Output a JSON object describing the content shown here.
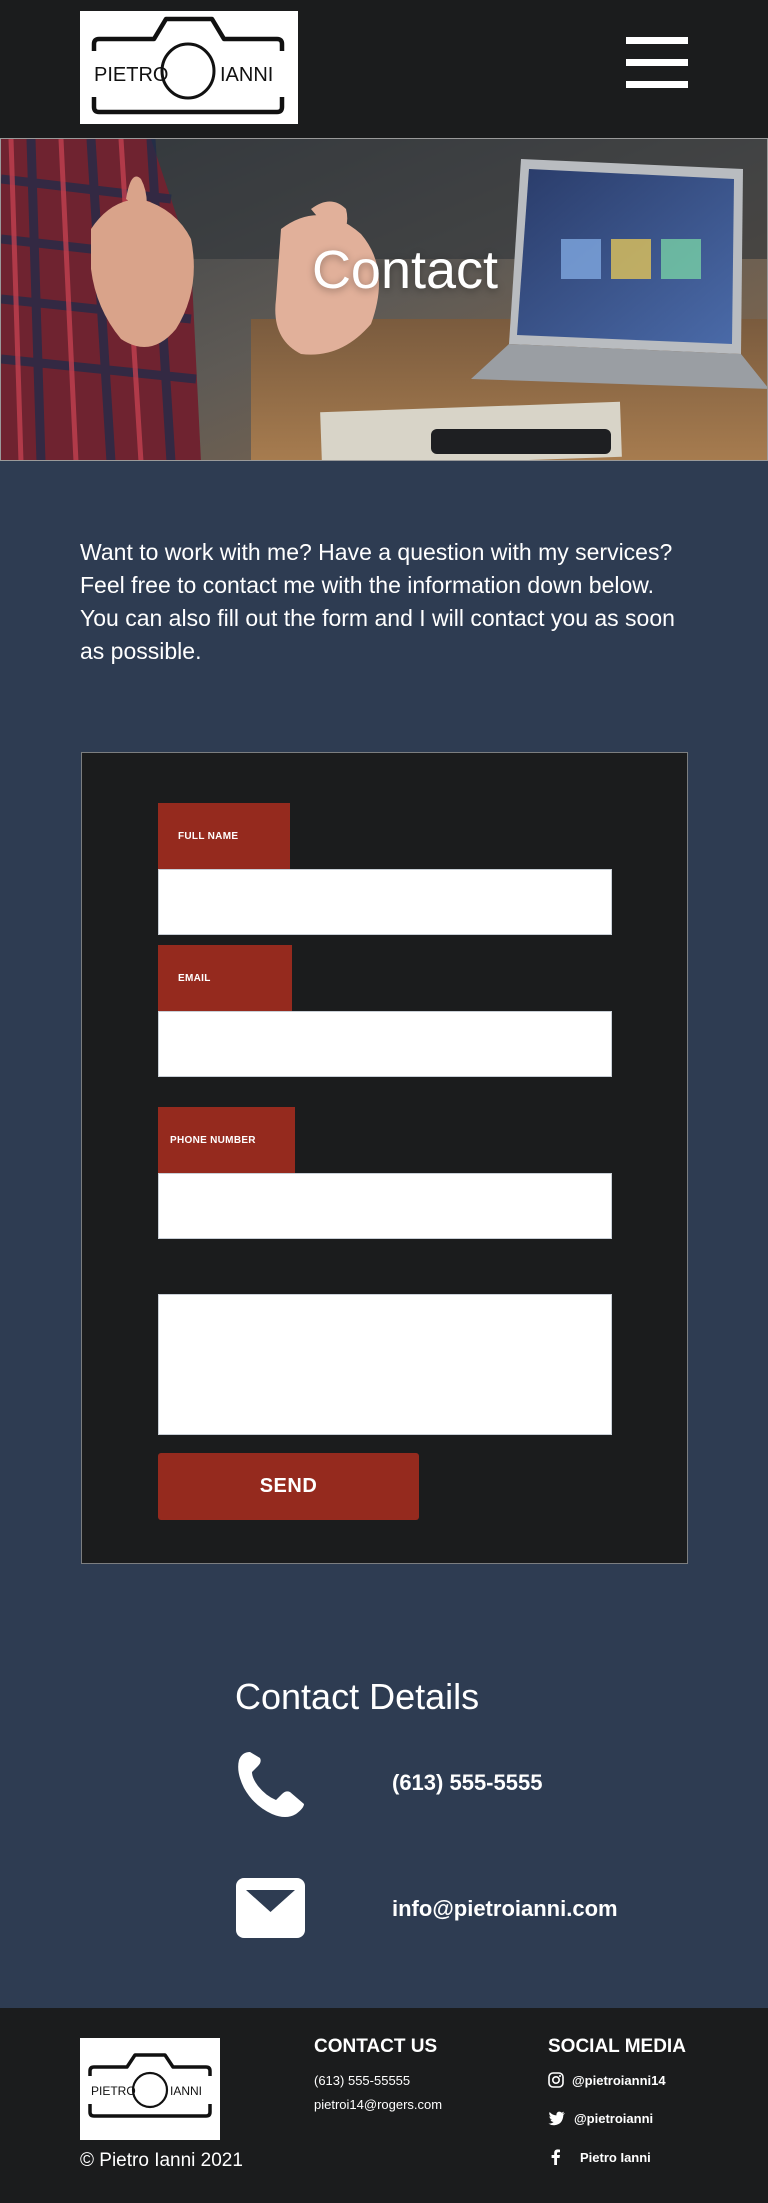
{
  "header": {
    "logo_left": "PIETRO",
    "logo_right": "IANNI",
    "menu_icon": "hamburger-menu-icon"
  },
  "hero": {
    "title": "Contact"
  },
  "intro": {
    "text": "Want to work with me? Have a question with my services? Feel free to contact me with the information down below. You can also fill out the form and I will contact you as soon as possible."
  },
  "form": {
    "full_name_label": "FULL NAME",
    "email_label": "EMAIL",
    "phone_label": "PHONE NUMBER",
    "full_name_value": "",
    "email_value": "",
    "phone_value": "",
    "message_value": "",
    "send_label": "SEND"
  },
  "contact_details": {
    "title": "Contact Details",
    "phone": "(613) 555-5555",
    "email": "info@pietroianni.com",
    "phone_icon": "phone-icon",
    "email_icon": "envelope-icon"
  },
  "footer": {
    "copyright": "© Pietro Ianni 2021",
    "contact_heading": "CONTACT US",
    "contact_phone": "(613) 555-55555",
    "contact_email": "pietroi14@rogers.com",
    "social_heading": "SOCIAL MEDIA",
    "instagram": "@pietroianni14",
    "twitter": "@pietroianni",
    "facebook": "Pietro Ianni"
  },
  "colors": {
    "page_bg": "#2e3c52",
    "dark_bg": "#1b1c1d",
    "accent": "#952a1e",
    "text": "#ffffff"
  }
}
